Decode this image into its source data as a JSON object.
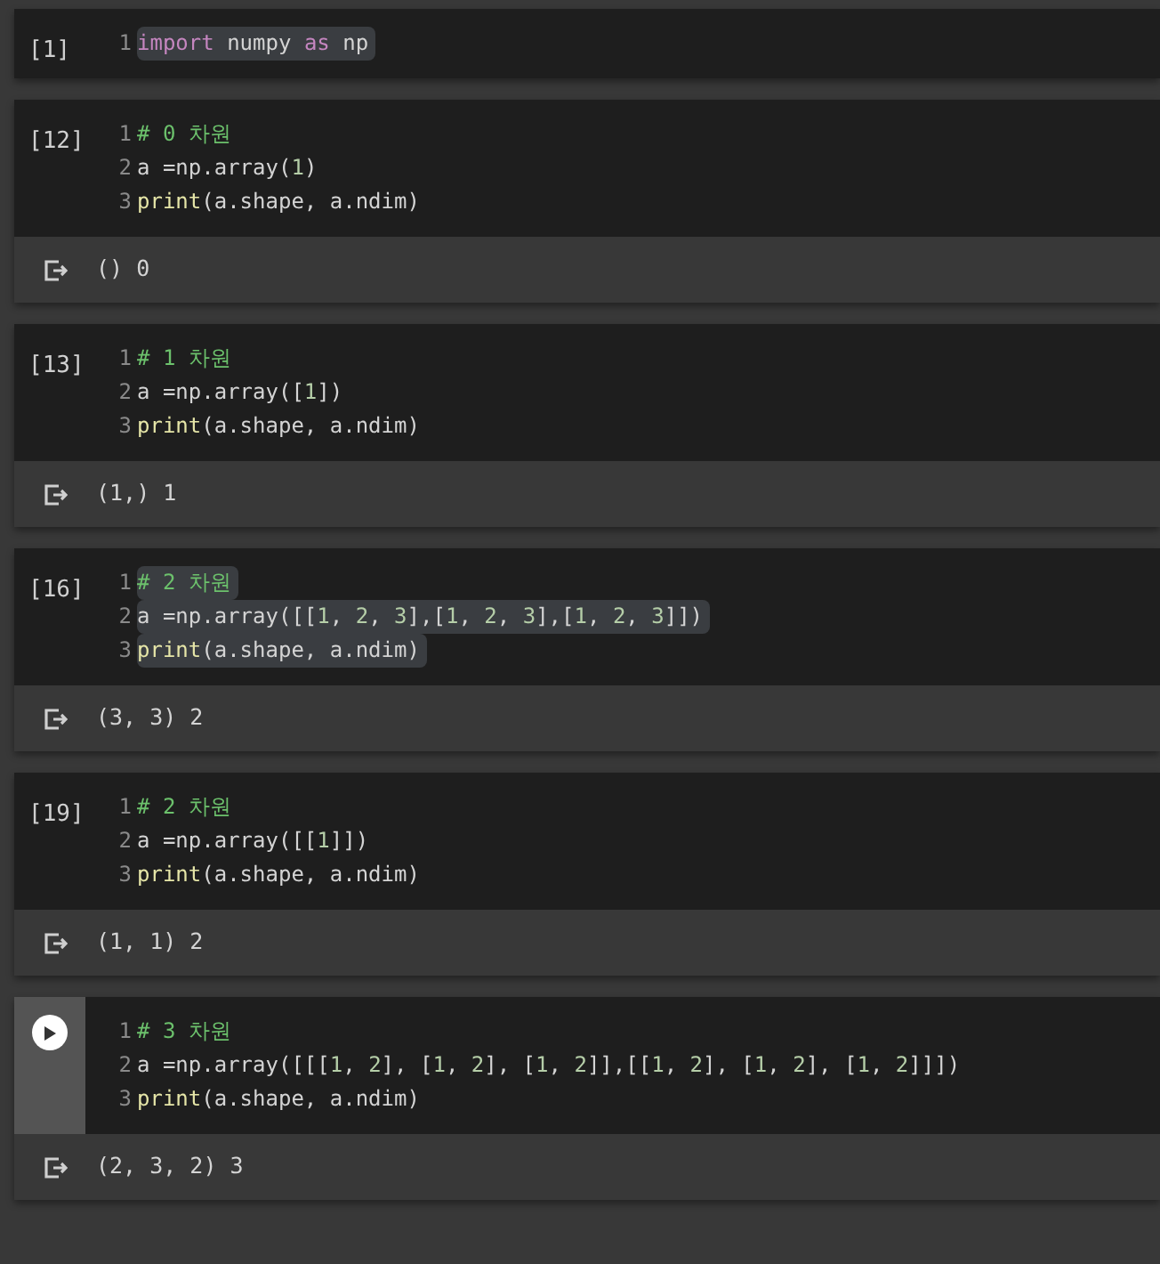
{
  "cells": [
    {
      "kind": "executed",
      "count": "[1]",
      "lines": [
        {
          "number": "1",
          "selected": true,
          "tokens": [
            {
              "text": "import",
              "kind": "keyword"
            },
            {
              "text": " numpy ",
              "kind": "plain"
            },
            {
              "text": "as",
              "kind": "keyword"
            },
            {
              "text": " np",
              "kind": "plain"
            }
          ]
        }
      ]
    },
    {
      "kind": "executed",
      "count": "[12]",
      "lines": [
        {
          "number": "1",
          "selected": false,
          "tokens": [
            {
              "text": "# 0 차원",
              "kind": "comment"
            }
          ]
        },
        {
          "number": "2",
          "selected": false,
          "tokens": [
            {
              "text": "a =np.array(",
              "kind": "plain"
            },
            {
              "text": "1",
              "kind": "number"
            },
            {
              "text": ")",
              "kind": "plain"
            }
          ]
        },
        {
          "number": "3",
          "selected": false,
          "tokens": [
            {
              "text": "print",
              "kind": "function"
            },
            {
              "text": "(a.shape, a.ndim)",
              "kind": "plain"
            }
          ]
        }
      ],
      "output": "() 0"
    },
    {
      "kind": "executed",
      "count": "[13]",
      "lines": [
        {
          "number": "1",
          "selected": false,
          "tokens": [
            {
              "text": "# 1 차원",
              "kind": "comment"
            }
          ]
        },
        {
          "number": "2",
          "selected": false,
          "tokens": [
            {
              "text": "a =np.array([",
              "kind": "plain"
            },
            {
              "text": "1",
              "kind": "number"
            },
            {
              "text": "])",
              "kind": "plain"
            }
          ]
        },
        {
          "number": "3",
          "selected": false,
          "tokens": [
            {
              "text": "print",
              "kind": "function"
            },
            {
              "text": "(a.shape, a.ndim)",
              "kind": "plain"
            }
          ]
        }
      ],
      "output": "(1,) 1"
    },
    {
      "kind": "executed",
      "count": "[16]",
      "lines": [
        {
          "number": "1",
          "selected": true,
          "tokens": [
            {
              "text": "# 2 차원",
              "kind": "comment"
            }
          ]
        },
        {
          "number": "2",
          "selected": true,
          "tokens": [
            {
              "text": "a =np.array([[",
              "kind": "plain"
            },
            {
              "text": "1",
              "kind": "number"
            },
            {
              "text": ", ",
              "kind": "plain"
            },
            {
              "text": "2",
              "kind": "number"
            },
            {
              "text": ", ",
              "kind": "plain"
            },
            {
              "text": "3",
              "kind": "number"
            },
            {
              "text": "],[",
              "kind": "plain"
            },
            {
              "text": "1",
              "kind": "number"
            },
            {
              "text": ", ",
              "kind": "plain"
            },
            {
              "text": "2",
              "kind": "number"
            },
            {
              "text": ", ",
              "kind": "plain"
            },
            {
              "text": "3",
              "kind": "number"
            },
            {
              "text": "],[",
              "kind": "plain"
            },
            {
              "text": "1",
              "kind": "number"
            },
            {
              "text": ", ",
              "kind": "plain"
            },
            {
              "text": "2",
              "kind": "number"
            },
            {
              "text": ", ",
              "kind": "plain"
            },
            {
              "text": "3",
              "kind": "number"
            },
            {
              "text": "]])",
              "kind": "plain"
            }
          ]
        },
        {
          "number": "3",
          "selected": true,
          "tokens": [
            {
              "text": "print",
              "kind": "function"
            },
            {
              "text": "(a.shape, a.ndim)",
              "kind": "plain"
            }
          ]
        }
      ],
      "output": "(3, 3) 2"
    },
    {
      "kind": "executed",
      "count": "[19]",
      "lines": [
        {
          "number": "1",
          "selected": false,
          "tokens": [
            {
              "text": "# 2 차원",
              "kind": "comment"
            }
          ]
        },
        {
          "number": "2",
          "selected": false,
          "tokens": [
            {
              "text": "a =np.array([[",
              "kind": "plain"
            },
            {
              "text": "1",
              "kind": "number"
            },
            {
              "text": "]])",
              "kind": "plain"
            }
          ]
        },
        {
          "number": "3",
          "selected": false,
          "tokens": [
            {
              "text": "print",
              "kind": "function"
            },
            {
              "text": "(a.shape, a.ndim)",
              "kind": "plain"
            }
          ]
        }
      ],
      "output": "(1, 1) 2"
    },
    {
      "kind": "run",
      "lines": [
        {
          "number": "1",
          "selected": false,
          "tokens": [
            {
              "text": "# 3 차원",
              "kind": "comment"
            }
          ]
        },
        {
          "number": "2",
          "selected": false,
          "tokens": [
            {
              "text": "a =np.array([[[",
              "kind": "plain"
            },
            {
              "text": "1",
              "kind": "number"
            },
            {
              "text": ", ",
              "kind": "plain"
            },
            {
              "text": "2",
              "kind": "number"
            },
            {
              "text": "], [",
              "kind": "plain"
            },
            {
              "text": "1",
              "kind": "number"
            },
            {
              "text": ", ",
              "kind": "plain"
            },
            {
              "text": "2",
              "kind": "number"
            },
            {
              "text": "], [",
              "kind": "plain"
            },
            {
              "text": "1",
              "kind": "number"
            },
            {
              "text": ", ",
              "kind": "plain"
            },
            {
              "text": "2",
              "kind": "number"
            },
            {
              "text": "]],[[",
              "kind": "plain"
            },
            {
              "text": "1",
              "kind": "number"
            },
            {
              "text": ", ",
              "kind": "plain"
            },
            {
              "text": "2",
              "kind": "number"
            },
            {
              "text": "], [",
              "kind": "plain"
            },
            {
              "text": "1",
              "kind": "number"
            },
            {
              "text": ", ",
              "kind": "plain"
            },
            {
              "text": "2",
              "kind": "number"
            },
            {
              "text": "], [",
              "kind": "plain"
            },
            {
              "text": "1",
              "kind": "number"
            },
            {
              "text": ", ",
              "kind": "plain"
            },
            {
              "text": "2",
              "kind": "number"
            },
            {
              "text": "]]])",
              "kind": "plain"
            }
          ]
        },
        {
          "number": "3",
          "selected": false,
          "tokens": [
            {
              "text": "print",
              "kind": "function"
            },
            {
              "text": "(a.shape, a.ndim)",
              "kind": "plain"
            }
          ]
        }
      ],
      "output": "(2, 3, 2) 3"
    }
  ]
}
